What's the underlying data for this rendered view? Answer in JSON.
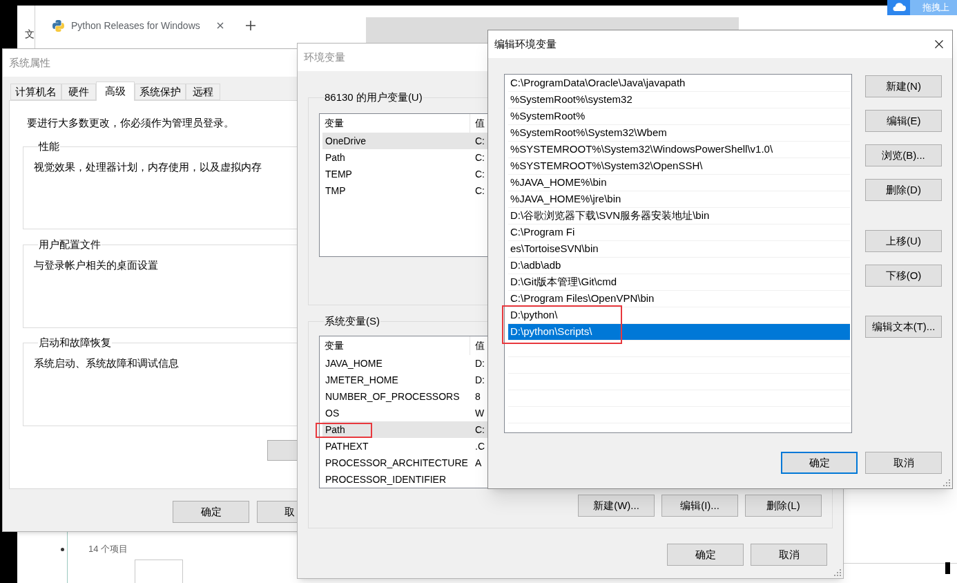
{
  "desktop": {
    "side_label": "文",
    "upload_badge": {
      "label": "拖拽上"
    },
    "explorer": {
      "status": "14 个项目"
    }
  },
  "browser": {
    "tab_title": "Python Releases for Windows"
  },
  "system_properties": {
    "title": "系统属性",
    "active": false,
    "tabs": [
      {
        "label": "计算机名",
        "selected": false
      },
      {
        "label": "硬件",
        "selected": false
      },
      {
        "label": "高级",
        "selected": true
      },
      {
        "label": "系统保护",
        "selected": false
      },
      {
        "label": "远程",
        "selected": false
      }
    ],
    "notice": "要进行大多数更改，你必须作为管理员登录。",
    "groups": [
      {
        "title": "性能",
        "description": "视觉效果，处理器计划，内存使用，以及虚拟内存"
      },
      {
        "title": "用户配置文件",
        "description": "与登录帐户相关的桌面设置"
      },
      {
        "title": "启动和故障恢复",
        "description": "系统启动、系统故障和调试信息"
      }
    ],
    "buttons": [
      "确定",
      "取"
    ]
  },
  "environment_variables": {
    "title": "环境变量",
    "active": false,
    "user_variables": {
      "title": "86130 的用户变量(U)",
      "columns": [
        "变量",
        "值"
      ],
      "rows": [
        {
          "name": "OneDrive",
          "value": "C:",
          "selected": true,
          "marked": false
        },
        {
          "name": "Path",
          "value": "C:",
          "selected": false,
          "marked": false
        },
        {
          "name": "TEMP",
          "value": "C:",
          "selected": false,
          "marked": false
        },
        {
          "name": "TMP",
          "value": "C:",
          "selected": false,
          "marked": false
        }
      ]
    },
    "system_variables": {
      "title": "系统变量(S)",
      "columns": [
        "变量",
        "值"
      ],
      "rows": [
        {
          "name": "JAVA_HOME",
          "value": "D:",
          "selected": false,
          "marked": false
        },
        {
          "name": "JMETER_HOME",
          "value": "D:",
          "selected": false,
          "marked": false
        },
        {
          "name": "NUMBER_OF_PROCESSORS",
          "value": "8",
          "selected": false,
          "marked": false
        },
        {
          "name": "OS",
          "value": "W",
          "selected": false,
          "marked": false
        },
        {
          "name": "Path",
          "value": "C:",
          "selected": true,
          "marked": true
        },
        {
          "name": "PATHEXT",
          "value": ".C",
          "selected": false,
          "marked": false
        },
        {
          "name": "PROCESSOR_ARCHITECTURE",
          "value": "A",
          "selected": false,
          "marked": false
        },
        {
          "name": "PROCESSOR_IDENTIFIER",
          "selected": false,
          "marked": false
        }
      ],
      "buttons": [
        "新建(W)...",
        "编辑(I)...",
        "删除(L)"
      ]
    },
    "buttons": [
      "确定",
      "取消"
    ]
  },
  "edit_dialog": {
    "title": "编辑环境变量",
    "active": true,
    "entries": [
      {
        "path": "C:\\ProgramData\\Oracle\\Java\\javapath",
        "selected": false,
        "marked": false
      },
      {
        "path": "%SystemRoot%\\system32",
        "selected": false,
        "marked": false
      },
      {
        "path": "%SystemRoot%",
        "selected": false,
        "marked": false
      },
      {
        "path": "%SystemRoot%\\System32\\Wbem",
        "selected": false,
        "marked": false
      },
      {
        "path": "%SYSTEMROOT%\\System32\\WindowsPowerShell\\v1.0\\",
        "selected": false,
        "marked": false
      },
      {
        "path": "%SYSTEMROOT%\\System32\\OpenSSH\\",
        "selected": false,
        "marked": false
      },
      {
        "path": "%JAVA_HOME%\\bin",
        "selected": false,
        "marked": false
      },
      {
        "path": "%JAVA_HOME%\\jre\\bin",
        "selected": false,
        "marked": false
      },
      {
        "path": "D:\\谷歌浏览器下载\\SVN服务器安装地址\\bin",
        "selected": false,
        "marked": false
      },
      {
        "path": "C:\\Program Fi",
        "selected": false,
        "marked": false
      },
      {
        "path": "es\\TortoiseSVN\\bin",
        "selected": false,
        "marked": false
      },
      {
        "path": "D:\\adb\\adb",
        "selected": false,
        "marked": false
      },
      {
        "path": "D:\\Git版本管理\\Git\\cmd",
        "selected": false,
        "marked": false
      },
      {
        "path": "C:\\Program Files\\OpenVPN\\bin",
        "selected": false,
        "marked": false
      },
      {
        "path": "D:\\python\\",
        "selected": false,
        "marked": true
      },
      {
        "path": "D:\\python\\Scripts\\",
        "selected": true,
        "marked": true
      }
    ],
    "side_button_groups": [
      [
        "新建(N)",
        "编辑(E)",
        "浏览(B)...",
        "删除(D)"
      ],
      [
        "上移(U)",
        "下移(O)"
      ],
      [
        "编辑文本(T)..."
      ]
    ],
    "buttons": [
      {
        "label": "确定",
        "focused": true
      },
      {
        "label": "取消",
        "focused": false
      }
    ]
  }
}
